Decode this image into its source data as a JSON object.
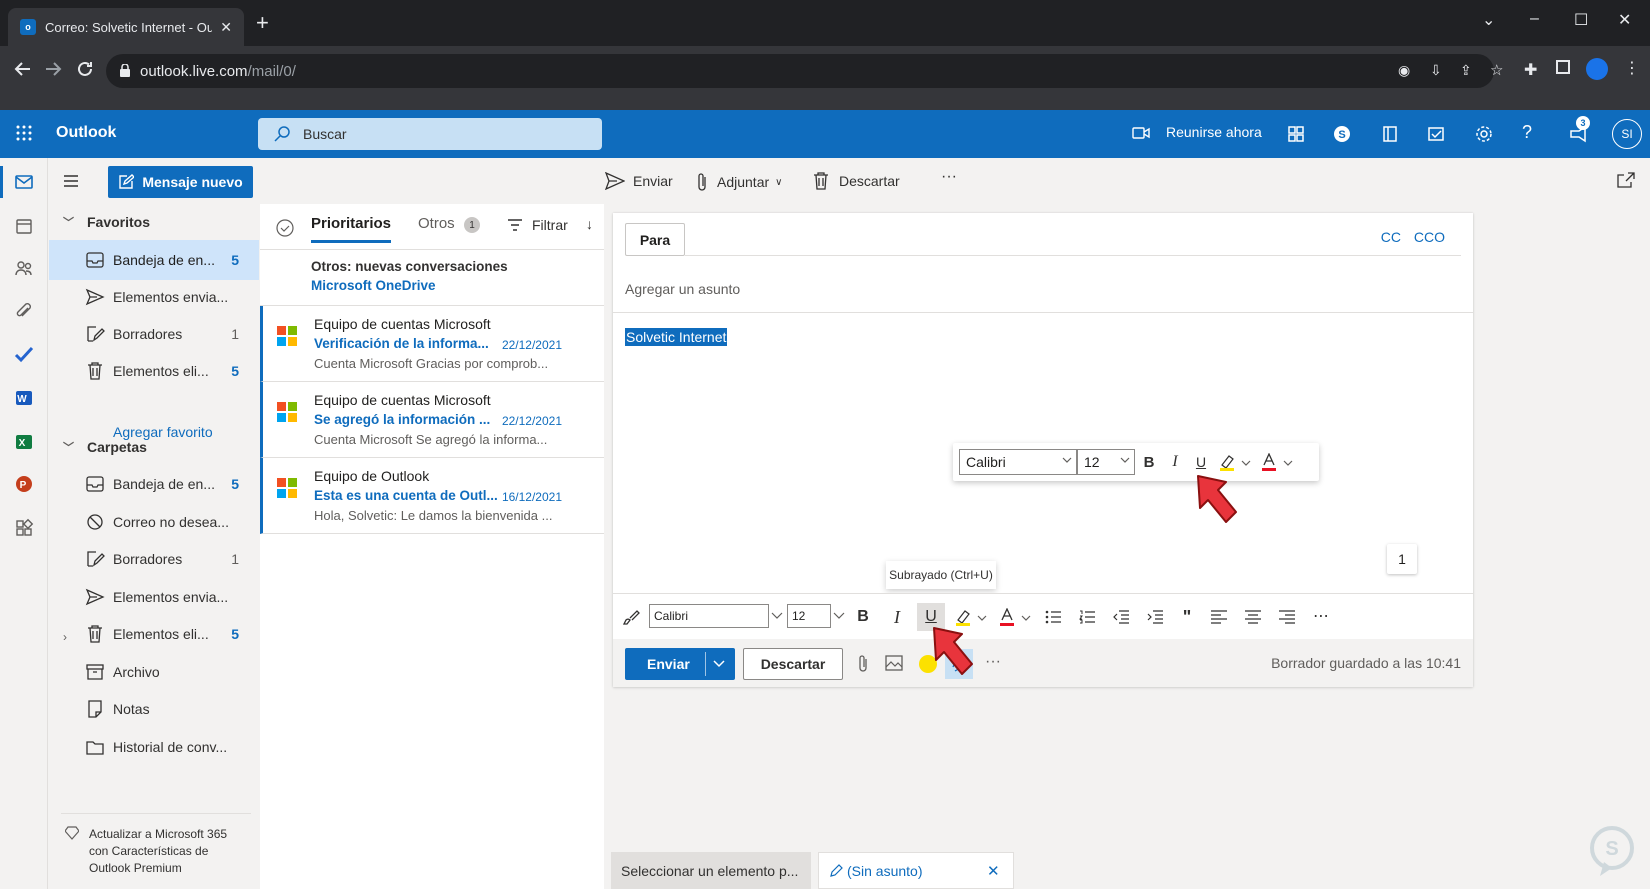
{
  "browser": {
    "tab_title": "Correo: Solvetic Internet - Outloo",
    "favicon_letter": "o",
    "url_host": "outlook.live.com",
    "url_path": "/mail/0/"
  },
  "header": {
    "app_name": "Outlook",
    "search_placeholder": "Buscar",
    "meet_now": "Reunirse ahora",
    "notification_count": "3",
    "avatar_initials": "SI"
  },
  "folders": {
    "new_message": "Mensaje nuevo",
    "favorites_header": "Favoritos",
    "favorites": [
      {
        "label": "Bandeja de en...",
        "count": "5",
        "icon": "inbox-icon"
      },
      {
        "label": "Elementos envia...",
        "count": "",
        "icon": "send-icon"
      },
      {
        "label": "Borradores",
        "count": "1",
        "icon": "drafts-icon"
      },
      {
        "label": "Elementos eli...",
        "count": "5",
        "icon": "trash-icon"
      }
    ],
    "add_favorite": "Agregar favorito",
    "folders_header": "Carpetas",
    "folders": [
      {
        "label": "Bandeja de en...",
        "count": "5",
        "icon": "inbox-icon"
      },
      {
        "label": "Correo no desea...",
        "count": "",
        "icon": "junk-icon"
      },
      {
        "label": "Borradores",
        "count": "1",
        "icon": "drafts-icon"
      },
      {
        "label": "Elementos envia...",
        "count": "",
        "icon": "send-icon"
      },
      {
        "label": "Elementos eli...",
        "count": "5",
        "icon": "trash-icon"
      },
      {
        "label": "Archivo",
        "count": "",
        "icon": "archive-icon"
      },
      {
        "label": "Notas",
        "count": "",
        "icon": "notes-icon"
      },
      {
        "label": "Historial de conv...",
        "count": "",
        "icon": "history-icon"
      }
    ],
    "upgrade": "Actualizar a Microsoft 365 con Características de Outlook Premium"
  },
  "message_list": {
    "tab_focused": "Prioritarios",
    "tab_other": "Otros",
    "other_count": "1",
    "filter": "Filtrar",
    "notice_title": "Otros: nuevas conversaciones",
    "notice_sender": "Microsoft OneDrive",
    "messages": [
      {
        "from": "Equipo de cuentas Microsoft",
        "subject": "Verificación de la informa...",
        "date": "22/12/2021",
        "preview": "Cuenta Microsoft Gracias por comprob..."
      },
      {
        "from": "Equipo de cuentas Microsoft",
        "subject": "Se agregó la información ...",
        "date": "22/12/2021",
        "preview": "Cuenta Microsoft Se agregó la informa..."
      },
      {
        "from": "Equipo de Outlook",
        "subject": "Esta es una cuenta de Outl...",
        "date": "16/12/2021",
        "preview": "Hola, Solvetic: Le damos la bienvenida ..."
      }
    ]
  },
  "command_bar": {
    "send": "Enviar",
    "attach": "Adjuntar",
    "discard": "Descartar",
    "more": "···"
  },
  "compose": {
    "to_button": "Para",
    "cc": "CC",
    "bcc": "CCO",
    "subject_placeholder": "Agregar un asunto",
    "body_text": "Solvetic Internet",
    "float_font": "Calibri",
    "float_size": "12",
    "page_count": "1",
    "tooltip": "Subrayado (Ctrl+U)",
    "toolbar_font": "Calibri",
    "toolbar_size": "12",
    "send_button": "Enviar",
    "discard_button": "Descartar",
    "saved_status": "Borrador guardado a las 10:41",
    "more": "···"
  },
  "bottom_tabs": {
    "tab1": "Seleccionar un elemento p...",
    "tab2": "(Sin asunto)"
  },
  "colors": {
    "brand": "#0f6cbd",
    "arrow": "#e8343c"
  }
}
